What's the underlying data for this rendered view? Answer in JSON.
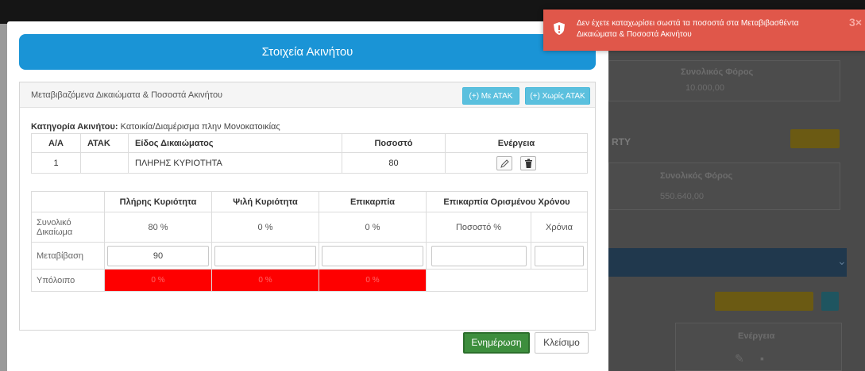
{
  "background": {
    "label_foros": "Συνολικός Φόρος",
    "value_1": "10.000,00",
    "partial_heading": "RTY",
    "label_foros_2": "Συνολικός Φόρος",
    "value_2": "550.640,00",
    "col_energeia": "Ενέργεια"
  },
  "toast": {
    "message": "Δεν έχετε καταχωρίσει σωστά τα ποσοστά στα Μεταβιβασθέντα Δικαιώματα & Ποσοστά Ακινήτου",
    "close": "3×"
  },
  "modal": {
    "title": "Στοιχεία Ακινήτου",
    "box_title": "Μεταβιβαζόμενα Δικαιώματα & Ποσοστά Ακινήτου",
    "btn_with_atak": "(+) Με ΑΤΑΚ",
    "btn_without_atak": "(+) Χωρίς ΑΤΑΚ",
    "category_label": "Κατηγορία Ακινήτου:",
    "category_value": "Κατοικία/Διαμέρισμα πλην Μονοκατοικίας",
    "rights_table": {
      "headers": [
        "Α/Α",
        "ΑΤΑΚ",
        "Είδος Δικαιώματος",
        "Ποσοστό",
        "Ενέργεια"
      ],
      "rows": [
        {
          "aa": "1",
          "atak": "",
          "type": "ΠΛΗΡΗΣ ΚΥΡΙΟΤΗΤΑ",
          "percent": "80"
        }
      ]
    },
    "pct_table": {
      "headers": [
        "",
        "Πλήρης Κυριότητα",
        "Ψιλή Κυριότητα",
        "Επικαρπία",
        "Επικαρπία Ορισμένου Χρόνου"
      ],
      "total_label": "Συνολικό Δικαίωμα",
      "total": [
        "80 %",
        "0 %",
        "0 %",
        "Ποσοστό %",
        "Χρόνια"
      ],
      "transfer_label": "Μεταβίβαση",
      "transfer": [
        "90",
        "",
        "",
        "",
        ""
      ],
      "rest_label": "Υπόλοιπο",
      "rest": [
        "0 %",
        "0 %",
        "0 %"
      ]
    },
    "btn_update": "Ενημέρωση",
    "btn_close": "Κλείσιμο"
  }
}
